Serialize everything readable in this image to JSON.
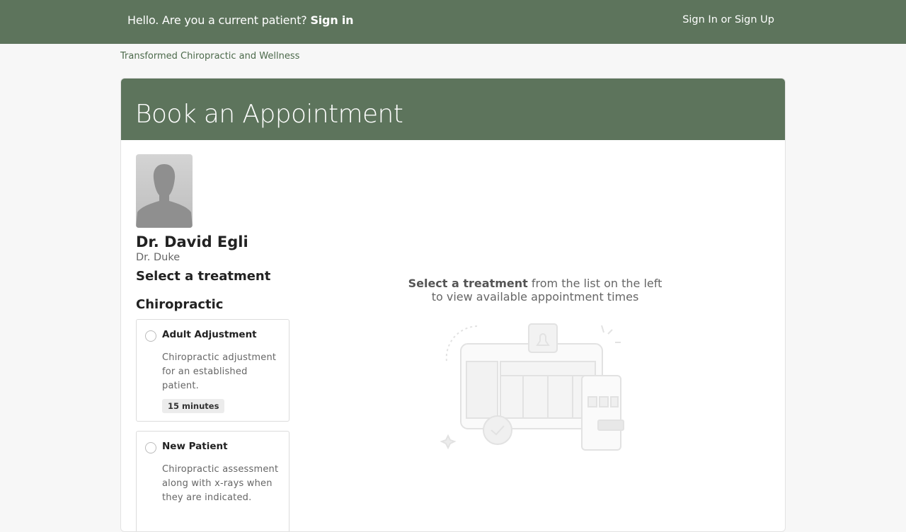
{
  "topbar": {
    "greeting_text": "Hello. Are you a current patient?",
    "signin_link": "Sign in",
    "auth_link": "Sign In or Sign Up"
  },
  "breadcrumb": "Transformed Chiropractic and Wellness",
  "page": {
    "title": "Book an Appointment"
  },
  "provider": {
    "name": "Dr. David Egli",
    "subtitle": "Dr. Duke"
  },
  "treatments": {
    "heading": "Select a treatment",
    "category": "Chiropractic",
    "items": [
      {
        "title": "Adult Adjustment",
        "description": "Chiropractic adjustment for an established patient.",
        "duration": "15 minutes"
      },
      {
        "title": "New Patient",
        "description": "Chiropractic assessment along with x-rays when they are indicated."
      }
    ]
  },
  "empty_state": {
    "bold": "Select a treatment",
    "rest_line1": "from the list on the left",
    "line2": "to view available appointment times"
  },
  "colors": {
    "brand_green": "#5d745c",
    "breadcrumb_green": "#4c6a4b"
  },
  "icons": [
    "avatar-silhouette-icon",
    "calendar-illustration"
  ]
}
